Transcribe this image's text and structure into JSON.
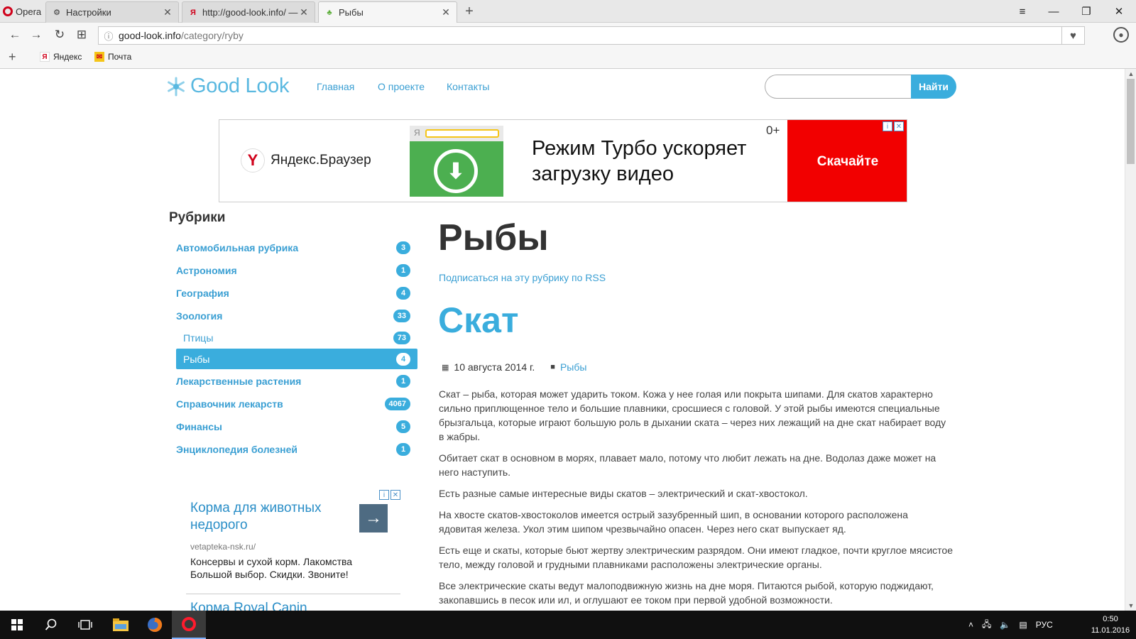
{
  "browser": {
    "menu_label": "Opera",
    "tabs": [
      {
        "title": "Настройки",
        "icon": "gear-icon",
        "active": false
      },
      {
        "title": "http://good-look.info/ —",
        "icon": "yandex-icon",
        "active": false
      },
      {
        "title": "Рыбы",
        "icon": "site-favicon",
        "active": true
      }
    ],
    "url_host": "good-look.info",
    "url_path": "/category/ryby",
    "bookmarks": [
      {
        "label": "Яндекс",
        "icon": "yandex-icon"
      },
      {
        "label": "Почта",
        "icon": "mail-icon"
      }
    ]
  },
  "site": {
    "logo_text": "Good Look",
    "nav": [
      "Главная",
      "О проекте",
      "Контакты"
    ],
    "search_placeholder": "",
    "search_button": "Найти"
  },
  "banner": {
    "brand": "Яндекс.Браузер",
    "ya_letter": "Я",
    "headline_line1": "Режим Турбо ускоряет",
    "headline_line2": "загрузку видео",
    "age": "0+",
    "cta": "Скачайте"
  },
  "sidebar": {
    "title": "Рубрики",
    "categories": [
      {
        "label": "Автомобильная рубрика",
        "count": "3"
      },
      {
        "label": "Астрономия",
        "count": "1"
      },
      {
        "label": "География",
        "count": "4"
      },
      {
        "label": "Зоология",
        "count": "33"
      },
      {
        "label": "Птицы",
        "count": "73"
      },
      {
        "label": "Рыбы",
        "count": "4"
      },
      {
        "label": "Лекарственные растения",
        "count": "1"
      },
      {
        "label": "Справочник лекарств",
        "count": "4067"
      },
      {
        "label": "Финансы",
        "count": "5"
      },
      {
        "label": "Энциклопедия болезней",
        "count": "1"
      }
    ],
    "ad": {
      "title": "Корма для животных недорого",
      "url": "vetapteka-nsk.ru/",
      "desc": "Консервы и сухой корм. Лакомства Большой выбор. Скидки. Звоните!",
      "next_title": "Корма Royal Canin"
    }
  },
  "main": {
    "category_title": "Рыбы",
    "rss_link": "Подписаться на эту рубрику по RSS",
    "post_title": "Скат",
    "post_date": "10 августа 2014 г.",
    "post_category": "Рыбы",
    "paragraphs": [
      "Скат – рыба, которая может ударить током. Кожа у нее голая или покрыта шипами. Для скатов характерно сильно приплющенное тело и большие плавники, сросшиеся с головой. У этой рыбы имеются специальные брызгальца, которые играют большую роль в дыхании ската – через них лежащий на дне скат набирает воду в жабры.",
      "Обитает скат в основном в морях, плавает мало, потому что любит лежать на дне. Водолаз даже может на него наступить.",
      "Есть разные самые интересные виды скатов – электрический и скат-хвостокол.",
      "На хвосте скатов-хвостоколов имеется острый зазубренный шип, в основании которого расположена ядовитая железа. Укол этим шипом чрезвычайно опасен. Через него скат выпускает яд.",
      "Есть еще и скаты, которые бьют жертву электрическим разрядом. Они имеют гладкое, почти круглое мясистое тело, между головой и грудными плавниками расположены электрические органы.",
      "Все электрические скаты ведут малоподвижную жизнь на дне моря. Питаются рыбой, которую поджидают, закопавшись в песок или ил, и оглушают ее током при первой удобной возможности."
    ]
  },
  "taskbar": {
    "lang": "РУС",
    "time": "0:50",
    "date": "11.01.2016"
  },
  "colors": {
    "accent": "#3aaddd",
    "link": "#3a9fd3",
    "ad_red": "#f20000",
    "ad_green": "#4caf50"
  }
}
